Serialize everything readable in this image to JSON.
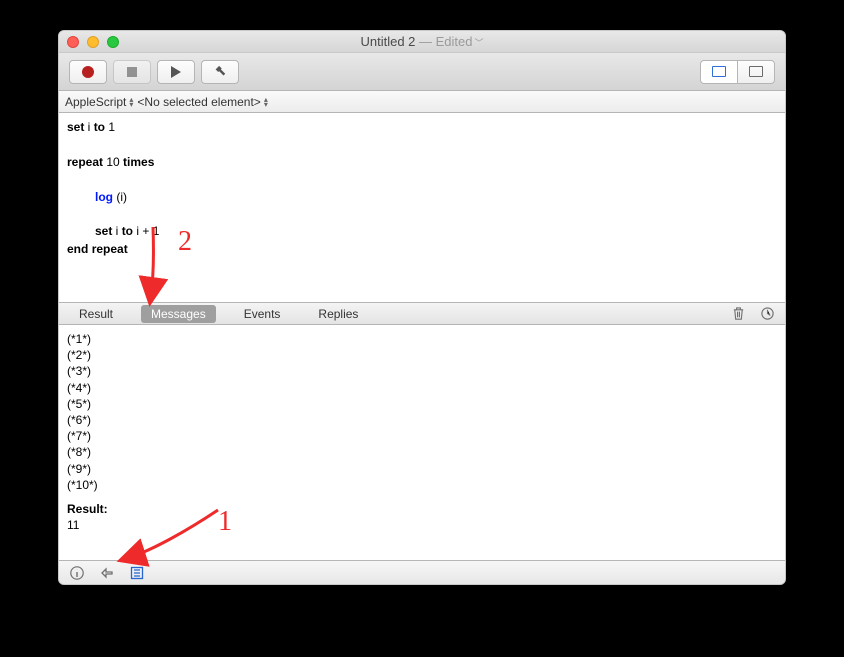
{
  "window": {
    "title": "Untitled 2",
    "edited_suffix": " — Edited"
  },
  "navbar": {
    "language": "AppleScript",
    "element": "<No selected element>"
  },
  "code": {
    "l1_a": "set",
    "l1_b": " i ",
    "l1_c": "to",
    "l1_d": " 1",
    "l3_a": "repeat",
    "l3_b": " 10 ",
    "l3_c": "times",
    "l5_a": "log",
    "l5_b": " (i)",
    "l7_a": "set",
    "l7_b": " i ",
    "l7_c": "to",
    "l7_d": " i + 1",
    "l8_a": "end",
    "l8_b": " ",
    "l8_c": "repeat"
  },
  "tabs": {
    "result": "Result",
    "messages": "Messages",
    "events": "Events",
    "replies": "Replies"
  },
  "output": {
    "lines": [
      "(*1*)",
      "(*2*)",
      "(*3*)",
      "(*4*)",
      "(*5*)",
      "(*6*)",
      "(*7*)",
      "(*8*)",
      "(*9*)",
      "(*10*)"
    ],
    "result_label": "Result:",
    "result_value": "11"
  },
  "annotations": {
    "n1": "1",
    "n2": "2"
  }
}
